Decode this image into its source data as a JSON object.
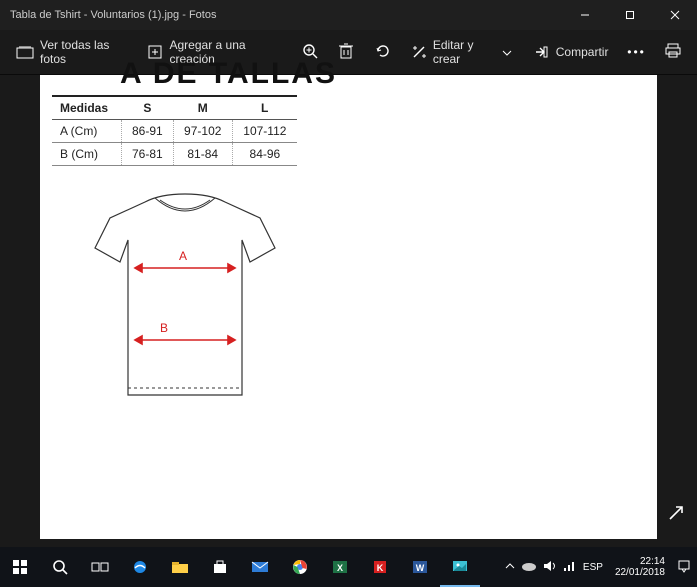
{
  "titlebar": {
    "text": "Tabla de Tshirt - Voluntarios (1).jpg - Fotos"
  },
  "toolbar": {
    "view_all": "Ver todas las fotos",
    "add_creation": "Agregar a una creación",
    "edit_create": "Editar y crear",
    "share": "Compartir"
  },
  "document": {
    "banner": "A DE TALLAS",
    "table": {
      "headers": [
        "Medidas",
        "S",
        "M",
        "L"
      ],
      "rows": [
        [
          "A (Cm)",
          "86-91",
          "97-102",
          "107-112"
        ],
        [
          "B (Cm)",
          "76-81",
          "81-84",
          "84-96"
        ]
      ]
    },
    "arrows": {
      "a_label": "A",
      "b_label": "B"
    }
  },
  "tray": {
    "lang": "ESP",
    "time": "22:14",
    "date": "22/01/2018"
  },
  "colors": {
    "arrow": "#d62020",
    "accent": "#0078d7"
  }
}
